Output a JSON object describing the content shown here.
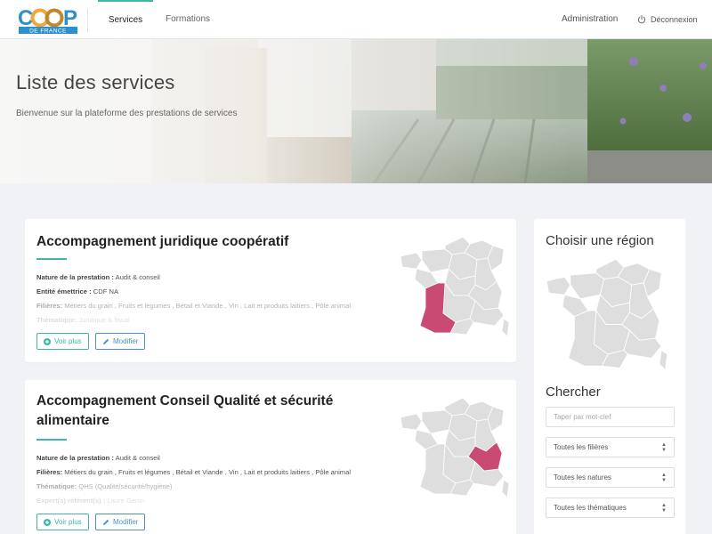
{
  "nav": {
    "logo_text": "COOP",
    "logo_subtext": "DE FRANCE",
    "tabs": [
      {
        "label": "Services",
        "active": true
      },
      {
        "label": "Formations",
        "active": false
      }
    ],
    "admin_label": "Administration",
    "logout_label": "Déconnexion"
  },
  "hero": {
    "title": "Liste des services",
    "subtitle": "Bienvenue sur la plateforme des prestations de services"
  },
  "services": [
    {
      "title": "Accompagnement juridique coopératif",
      "fields": [
        {
          "label": "Nature de la prestation :",
          "value": "Audit & conseil"
        },
        {
          "label": "Entité émettrice :",
          "value": "CDF NA"
        },
        {
          "label": "Filières:",
          "value": "Métiers du grain , Fruits et légumes , Bétail et Viande , Vin , Lait et produits laitiers , Pôle animal"
        },
        {
          "label": "Thématique:",
          "value": "Juridique & fiscal"
        }
      ],
      "view_label": "Voir plus",
      "edit_label": "Modifier",
      "highlighted_region": "Nouvelle-Aquitaine"
    },
    {
      "title": "Accompagnement Conseil Qualité et sécurité alimentaire",
      "fields": [
        {
          "label": "Nature de la prestation :",
          "value": "Audit & conseil"
        },
        {
          "label": "Filières:",
          "value": "Métiers du grain , Fruits et légumes , Bétail et Viande , Vin , Lait et produits laitiers , Pôle animal"
        },
        {
          "label": "Thématique:",
          "value": "QHS (Qualité/sécurité/hygiène)"
        },
        {
          "label": "Expert(s) référent(s) :",
          "value": "Laure Genin"
        }
      ],
      "view_label": "Voir plus",
      "edit_label": "Modifier",
      "highlighted_region": "Auvergne-Rhône-Alpes"
    }
  ],
  "sidebar": {
    "region_title": "Choisir une région",
    "search_title": "Chercher",
    "search_placeholder": "Taper par mot-clef",
    "filters": [
      "Toutes les filières",
      "Toutes les natures",
      "Toutes les thématiques"
    ]
  },
  "colors": {
    "accent": "#3fb6a8",
    "edit_blue": "#4a90d0",
    "map_fill": "#dedede",
    "map_highlight": "#c94a72"
  },
  "icons": [
    "power-icon",
    "plus-circle-icon",
    "pencil-icon",
    "france-map-icon"
  ]
}
